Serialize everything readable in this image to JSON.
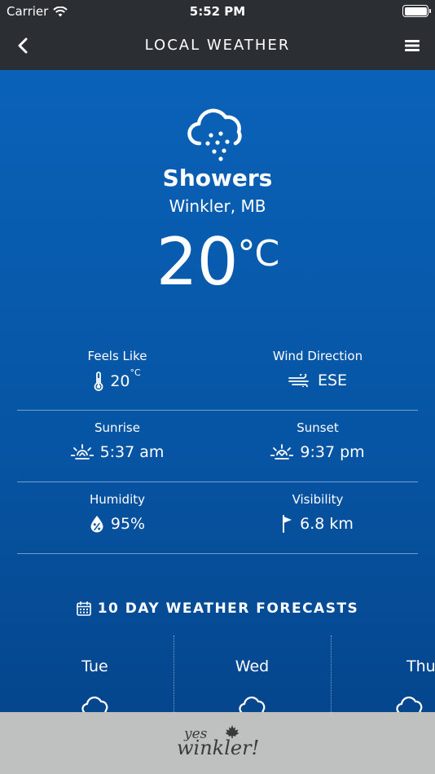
{
  "status_bar": {
    "carrier": "Carrier",
    "time": "5:52 PM",
    "battery_level": 1.0
  },
  "nav": {
    "title": "LOCAL WEATHER",
    "back_icon": "chevron-left-icon",
    "menu_icon": "hamburger-menu-icon"
  },
  "current": {
    "icon": "rain-showers-icon",
    "condition": "Showers",
    "location": "Winkler, MB",
    "temperature": "20",
    "unit": "°C"
  },
  "stats": {
    "feels_like": {
      "label": "Feels Like",
      "value": "20",
      "unit": "°C",
      "icon": "thermometer-icon"
    },
    "wind_direction": {
      "label": "Wind Direction",
      "value": "ESE",
      "icon": "wind-icon"
    },
    "sunrise": {
      "label": "Sunrise",
      "value": "5:37 am",
      "icon": "sunrise-icon"
    },
    "sunset": {
      "label": "Sunset",
      "value": "9:37 pm",
      "icon": "sunset-icon"
    },
    "humidity": {
      "label": "Humidity",
      "value": "95%",
      "icon": "humidity-drop-icon"
    },
    "visibility": {
      "label": "Visibility",
      "value": "6.8 km",
      "icon": "flag-icon"
    }
  },
  "forecast": {
    "title": "10 DAY WEATHER FORECASTS",
    "icon": "calendar-icon",
    "days": [
      {
        "name": "Tue",
        "icon": "cloud-icon"
      },
      {
        "name": "Wed",
        "icon": "cloud-icon"
      },
      {
        "name": "Thu",
        "icon": "cloud-icon"
      }
    ]
  },
  "footer": {
    "logo_line1": "yes",
    "logo_line2": "winkler!"
  },
  "colors": {
    "nav_bg": "#2b2f33",
    "main_bg": "#0a62b8",
    "footer_bg": "#bfc0c0"
  }
}
